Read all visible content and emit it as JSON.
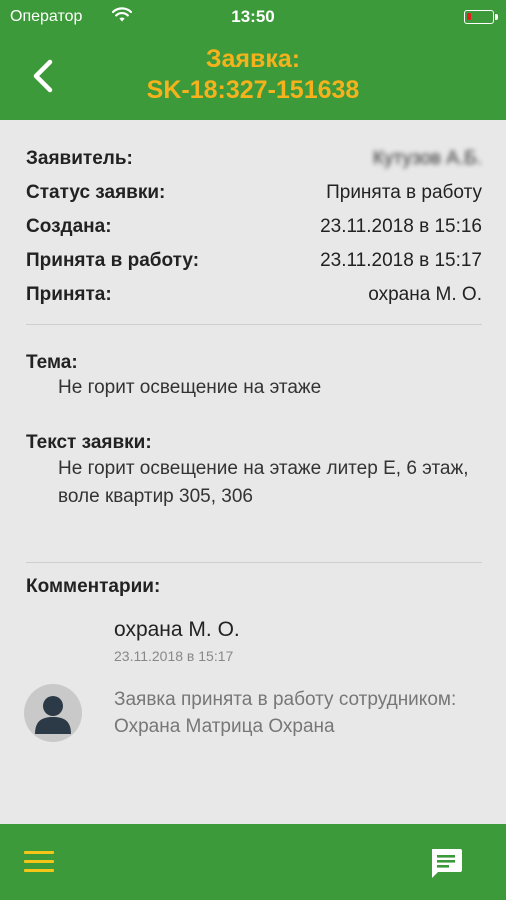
{
  "status_bar": {
    "carrier": "Оператор",
    "time": "13:50",
    "battery_level": 0.15,
    "battery_color": "#e02020"
  },
  "nav": {
    "title_line1": "Заявка:",
    "title_line2": "SK-18:327-151638",
    "back_icon": "chevron-left-icon",
    "title_color": "#f5b21c",
    "bar_color": "#3d9a3a"
  },
  "details": {
    "applicant_label": "Заявитель:",
    "applicant_value": "Кутузов А.Б.",
    "status_label": "Статус заявки:",
    "status_value": "Принята в работу",
    "created_label": "Создана:",
    "created_value": "23.11.2018 в 15:16",
    "accepted_label": "Принята в работу:",
    "accepted_value": "23.11.2018 в 15:17",
    "acceptedby_label": "Принята:",
    "acceptedby_value": "охрана М. О."
  },
  "topic": {
    "label": "Тема:",
    "text": "Не горит освещение на этаже"
  },
  "request_text": {
    "label": "Текст заявки:",
    "text": "Не горит освещение на этаже литер Е, 6 этаж, воле квартир 305, 306"
  },
  "comments": {
    "label": "Комментарии:",
    "items": [
      {
        "author": "охрана М. О.",
        "date": "23.11.2018 в 15:17",
        "text": "Заявка принята в работу сотрудником: Охрана Матрица Охрана",
        "avatar_icon": "user-avatar-icon"
      }
    ]
  },
  "tabbar": {
    "menu_icon": "hamburger-menu-icon",
    "chat_icon": "chat-icon",
    "icon_color": "#f5c518"
  }
}
